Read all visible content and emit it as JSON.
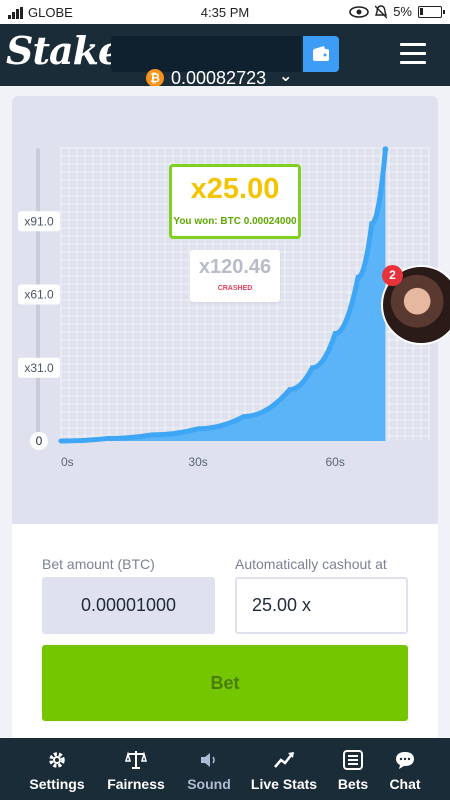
{
  "status_bar": {
    "carrier": "GLOBE",
    "time": "4:35 PM",
    "battery": "5%"
  },
  "header": {
    "logo": "Stake",
    "balance": "0.00082723",
    "currency_icon": "bitcoin-icon",
    "wallet_icon": "wallet-icon",
    "menu_icon": "hamburger-menu-icon"
  },
  "game": {
    "win_multiplier": "x25.00",
    "win_text": "You won: BTC 0.00024000",
    "crash_multiplier": "x120.46",
    "crash_label": "CRASHED",
    "notification_count": "2",
    "y_ticks": [
      "0",
      "x31.0",
      "x61.0",
      "x91.0"
    ],
    "x_ticks": [
      "0s",
      "30s",
      "60s"
    ]
  },
  "chart_data": {
    "type": "area",
    "title": "",
    "xlabel": "",
    "ylabel": "",
    "x_tick_labels": [
      "0s",
      "30s",
      "60s"
    ],
    "y_tick_labels": [
      "0",
      "x31.0",
      "x61.0",
      "x91.0"
    ],
    "xlim": [
      0,
      72
    ],
    "ylim": [
      1,
      121
    ],
    "x": [
      0,
      10,
      20,
      30,
      40,
      50,
      55,
      60,
      65,
      68,
      71
    ],
    "values": [
      1.0,
      2.0,
      3.5,
      6.0,
      11.0,
      22.0,
      31.0,
      45.0,
      68.0,
      90.0,
      120.46
    ],
    "series_color": "#3fa6f5",
    "grid": true
  },
  "controls": {
    "bet_amount_label": "Bet amount (BTC)",
    "bet_amount_value": "0.00001000",
    "cashout_label": "Automatically cashout at",
    "cashout_value": "25.00 x",
    "bet_button": "Bet"
  },
  "nav": [
    {
      "label": "Settings",
      "icon": "gear-icon"
    },
    {
      "label": "Fairness",
      "icon": "scales-icon"
    },
    {
      "label": "Sound",
      "icon": "speaker-icon"
    },
    {
      "label": "Live Stats",
      "icon": "trend-line-icon"
    },
    {
      "label": "Bets",
      "icon": "list-icon"
    },
    {
      "label": "Chat",
      "icon": "chat-bubble-icon"
    }
  ],
  "colors": {
    "accent_green": "#74c600",
    "header_bg": "#1a2c38",
    "wallet_blue": "#3d9cf5",
    "curve_blue": "#3fa6f5",
    "win_yellow": "#f5c400",
    "crash_red": "#e8405a"
  }
}
